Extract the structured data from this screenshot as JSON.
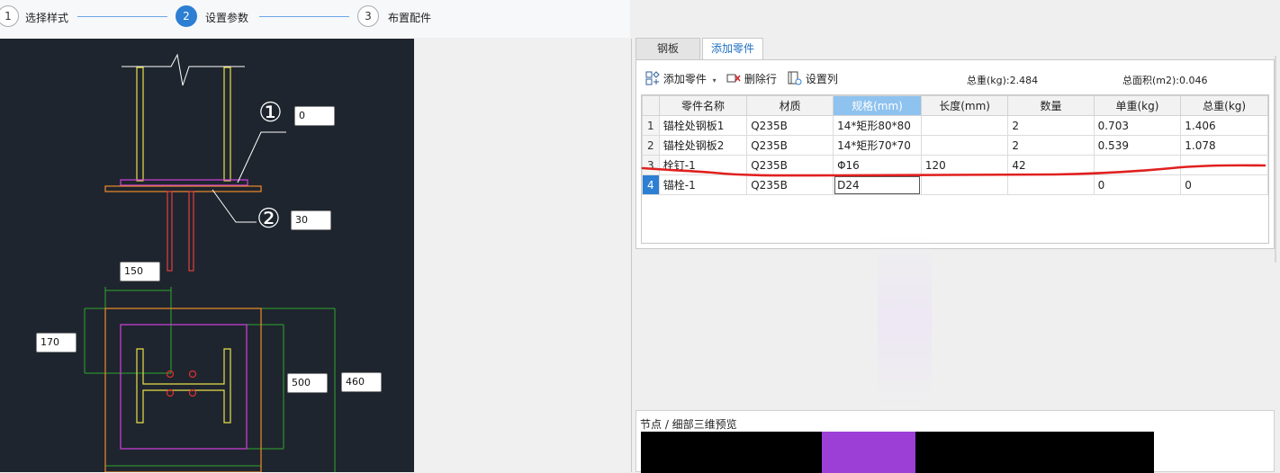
{
  "stepper": {
    "steps": [
      {
        "number": "1",
        "label": "选择样式"
      },
      {
        "number": "2",
        "label": "设置参数"
      },
      {
        "number": "3",
        "label": "布置配件"
      }
    ]
  },
  "cad": {
    "inputs": {
      "part1": "0",
      "part2": "30",
      "top_dim": "150",
      "left_dim": "170",
      "mid_dim": "500",
      "right_dim": "460"
    },
    "callouts": {
      "one": "①",
      "two": "②"
    }
  },
  "tabs": [
    {
      "label": "钢板"
    },
    {
      "label": "添加零件"
    }
  ],
  "toolbar": {
    "add_part": "添加零件",
    "delete_row": "删除行",
    "set_columns": "设置列",
    "total_weight": "总重(kg):2.484",
    "total_area": "总面积(m2):0.046"
  },
  "table": {
    "headers": [
      "零件名称",
      "材质",
      "规格(mm)",
      "长度(mm)",
      "数量",
      "单重(kg)",
      "总重(kg)"
    ],
    "rows": [
      {
        "no": "1",
        "cells": [
          "锚栓处钢板1",
          "Q235B",
          "14*矩形80*80",
          "",
          "2",
          "0.703",
          "1.406"
        ]
      },
      {
        "no": "2",
        "cells": [
          "锚栓处钢板2",
          "Q235B",
          "14*矩形70*70",
          "",
          "2",
          "0.539",
          "1.078"
        ]
      },
      {
        "no": "3",
        "cells": [
          "栓钉-1",
          "Q235B",
          "Φ16",
          "120",
          "42",
          "",
          ""
        ]
      },
      {
        "no": "4",
        "cells": [
          "锚栓-1",
          "Q235B",
          "D24",
          "",
          "",
          "0",
          "0"
        ]
      }
    ]
  },
  "preview": {
    "title": "节点 / 细部三维预览"
  },
  "colors": {
    "accent": "#2d7fd3",
    "cad_bg": "#1f252e",
    "annotation_red": "#e0201e"
  }
}
